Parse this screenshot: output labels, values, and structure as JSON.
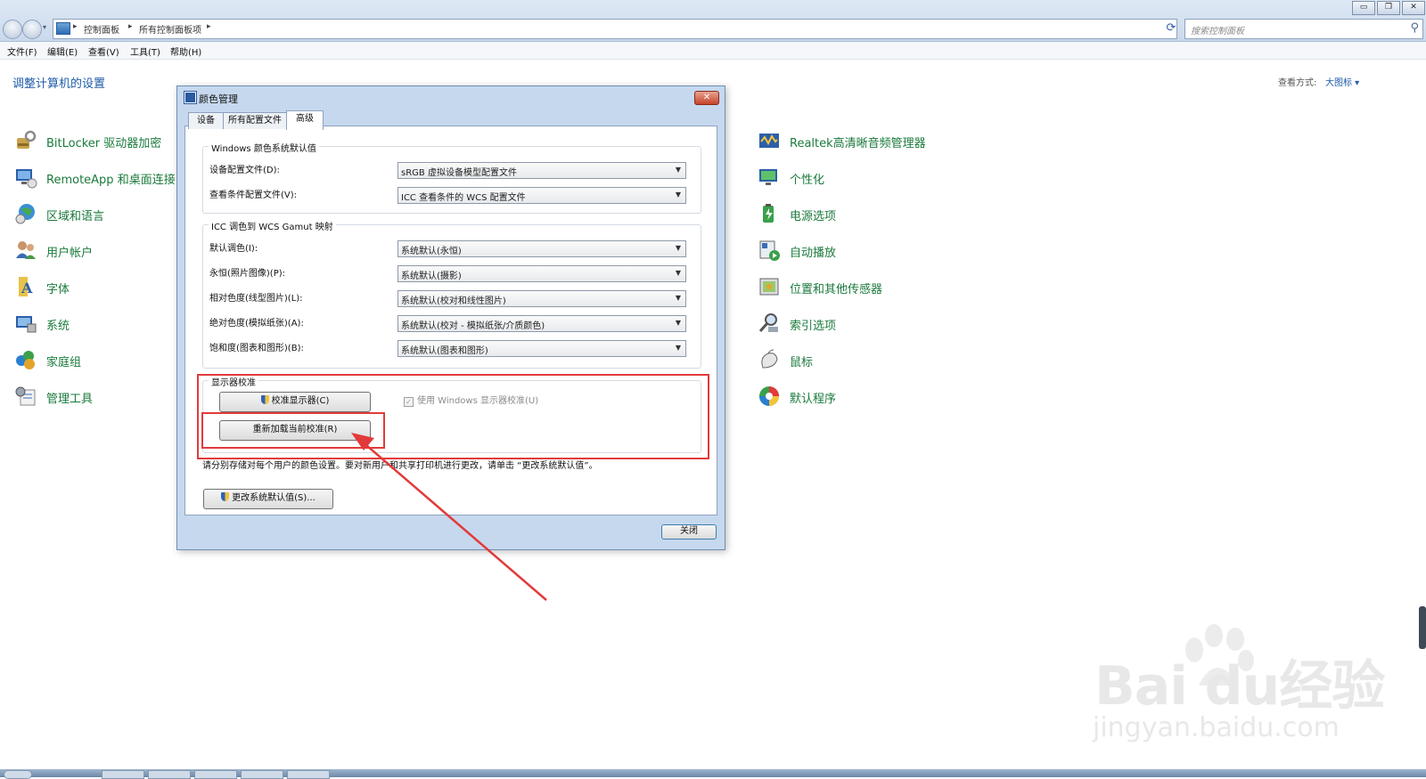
{
  "breadcrumb": {
    "root": "控制面板",
    "current": "所有控制面板项"
  },
  "search": {
    "placeholder": "搜索控制面板"
  },
  "menu": [
    "文件(F)",
    "编辑(E)",
    "查看(V)",
    "工具(T)",
    "帮助(H)"
  ],
  "page": {
    "title": "调整计算机的设置",
    "view_label": "查看方式:",
    "view_value": "大图标 ▾"
  },
  "left_items": [
    {
      "label": "BitLocker 驱动器加密",
      "icon": "bitlocker-icon"
    },
    {
      "label": "RemoteApp 和桌面连接",
      "icon": "remoteapp-icon"
    },
    {
      "label": "区域和语言",
      "icon": "region-language-icon"
    },
    {
      "label": "用户帐户",
      "icon": "user-accounts-icon"
    },
    {
      "label": "字体",
      "icon": "fonts-icon"
    },
    {
      "label": "系统",
      "icon": "system-icon"
    },
    {
      "label": "家庭组",
      "icon": "homegroup-icon"
    },
    {
      "label": "管理工具",
      "icon": "admin-tools-icon"
    }
  ],
  "right_items": [
    {
      "label": "Realtek高清晰音频管理器",
      "icon": "realtek-audio-icon"
    },
    {
      "label": "个性化",
      "icon": "personalization-icon"
    },
    {
      "label": "电源选项",
      "icon": "power-options-icon"
    },
    {
      "label": "自动播放",
      "icon": "autoplay-icon"
    },
    {
      "label": "位置和其他传感器",
      "icon": "location-sensors-icon"
    },
    {
      "label": "索引选项",
      "icon": "indexing-options-icon"
    },
    {
      "label": "鼠标",
      "icon": "mouse-icon"
    },
    {
      "label": "默认程序",
      "icon": "default-programs-icon"
    }
  ],
  "dialog": {
    "title": "颜色管理",
    "close_glyph": "✕",
    "tabs": [
      "设备",
      "所有配置文件",
      "高级"
    ],
    "active_tab": "高级",
    "group_defaults": {
      "title": "Windows 颜色系统默认值",
      "rows": [
        {
          "label": "设备配置文件(D):",
          "value": "sRGB 虚拟设备模型配置文件"
        },
        {
          "label": "查看条件配置文件(V):",
          "value": "ICC 查看条件的 WCS 配置文件"
        }
      ]
    },
    "group_mapping": {
      "title": "ICC 调色到 WCS Gamut 映射",
      "rows": [
        {
          "label": "默认调色(I):",
          "value": "系统默认(永恒)"
        },
        {
          "label": "永恒(照片图像)(P):",
          "value": "系统默认(摄影)"
        },
        {
          "label": "相对色度(线型图片)(L):",
          "value": "系统默认(校对和线性图片)"
        },
        {
          "label": "绝对色度(模拟纸张)(A):",
          "value": "系统默认(校对 - 模拟纸张/介质颜色)"
        },
        {
          "label": "饱和度(图表和图形)(B):",
          "value": "系统默认(图表和图形)"
        }
      ]
    },
    "group_calibration": {
      "title": "显示器校准",
      "calibrate_button": "校准显示器(C)",
      "reload_button": "重新加载当前校准(R)",
      "use_windows_calibration": "使用 Windows 显示器校准(U)",
      "use_windows_calibration_checked": true
    },
    "note": "请分别存储对每个用户的颜色设置。要对新用户和共享打印机进行更改，请单击 “更改系统默认值”。",
    "change_defaults_button": "更改系统默认值(S)...",
    "close_button": "关闭"
  },
  "window_controls": {
    "minimize": "▭",
    "restore": "❐",
    "close": "✕"
  },
  "watermark": {
    "brand": "Bai du经验",
    "url": "jingyan.baidu.com"
  },
  "colors": {
    "link_green": "#1a7a3c",
    "title_blue": "#1d5aa8",
    "annotation_red": "#e23a3a"
  }
}
